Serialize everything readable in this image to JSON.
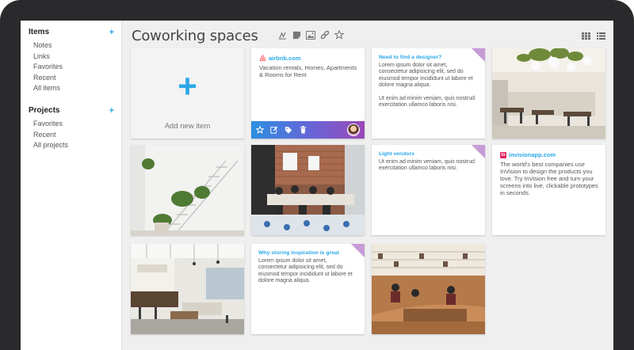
{
  "sidebar": {
    "items_section": {
      "title": "Items",
      "add_label": "+",
      "entries": [
        "Notes",
        "Links",
        "Favorites",
        "Recent",
        "All items"
      ]
    },
    "projects_section": {
      "title": "Projects",
      "add_label": "+",
      "entries": [
        "Favorites",
        "Recent",
        "All projects"
      ]
    }
  },
  "header": {
    "title": "Coworking spaces",
    "toolbar_icons": [
      "draw-icon",
      "note-icon",
      "image-icon",
      "link-icon",
      "star-icon"
    ],
    "view_icons": [
      "grid-view-icon",
      "list-view-icon"
    ]
  },
  "cards": {
    "add": {
      "plus": "+",
      "label": "Add new item"
    },
    "airbnb": {
      "domain": "airbnb.com",
      "description": "Vacation rentals, Homes, Apartments & Rooms for Rent",
      "actions": [
        "star-icon",
        "edit-icon",
        "tag-icon",
        "trash-icon"
      ]
    },
    "note_designer": {
      "title": "Need to find a designer?",
      "para1": "Lorem ipsum dolor sit amet, consectetur adipisicing elit, sed do eiusmod tempor incididunt ut labore et dolore magna aliqua.",
      "para2": "Ut enim ad minim veniam, quis nostrud exercitation ullamco laboris nisi."
    },
    "note_light": {
      "title": "Light vendors",
      "body": "Ut enim ad minim veniam, quis nostrud exercitation ullamco laboris nisi."
    },
    "invision": {
      "logo": "in",
      "domain": "invisionapp.com",
      "description": "The world's best companies use InVision to design the products you love. Try InVision free and turn your screens into live, clickable prototypes in seconds."
    },
    "note_inspiration": {
      "title": "Why storing inspiration is great",
      "body": "Lorem ipsum dolor sit amet, consectetur adipisicing elit, sed do eiusmod tempor incididunt ut labore et dolore magna aliqua."
    }
  },
  "colors": {
    "accent": "#2aa7e8",
    "fold": "#c79bd6",
    "airbnb": "#ff5a5f",
    "invision": "#e0245e"
  }
}
